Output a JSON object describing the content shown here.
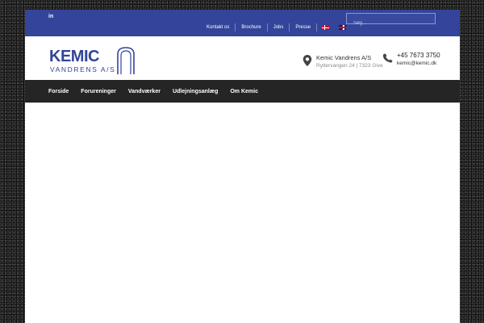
{
  "colors": {
    "brand": "#33449a",
    "nav_bg": "#252525"
  },
  "topbar": {
    "social": "in",
    "search_placeholder": "Søg...",
    "links": [
      "Kontakt os",
      "Brochure",
      "Jobs",
      "Presse"
    ],
    "flags": [
      "flag-dk-icon",
      "flag-uk-icon"
    ]
  },
  "header": {
    "logo_main": "KEMIC",
    "logo_sub": "VANDRENS A/S",
    "address_title": "Kemic Vandrens A/S",
    "address_line": "Ryttervangen 24 | 7323 Give",
    "phone": "+45 7673 3750",
    "email": "kemic@kemic.dk"
  },
  "mainnav": {
    "items": [
      "Forside",
      "Forureninger",
      "Vandværker",
      "Udlejningsanlæg",
      "Om Kemic"
    ]
  }
}
